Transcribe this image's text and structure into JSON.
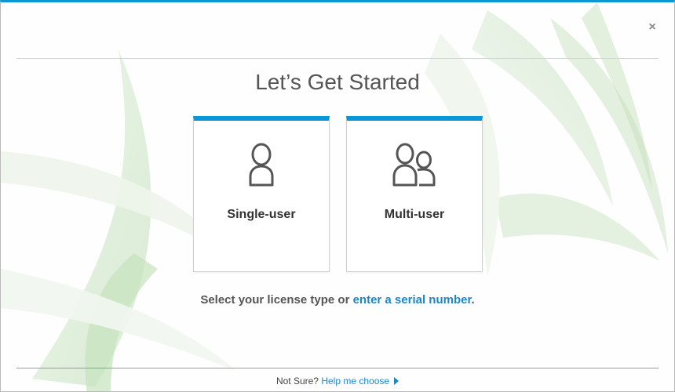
{
  "window": {
    "close_glyph": "×",
    "accent_color": "#0b96d6"
  },
  "title": "Let’s Get Started",
  "cards": [
    {
      "label": "Single-user",
      "icon": "single-user-icon"
    },
    {
      "label": "Multi-user",
      "icon": "multi-user-icon"
    }
  ],
  "prompt": {
    "text_before": "Select your license type or ",
    "link_text": "enter a serial number",
    "text_after": "."
  },
  "footer": {
    "not_sure": "Not Sure?",
    "help_link": "Help me choose",
    "arrow_icon": "triangle-right-icon"
  }
}
